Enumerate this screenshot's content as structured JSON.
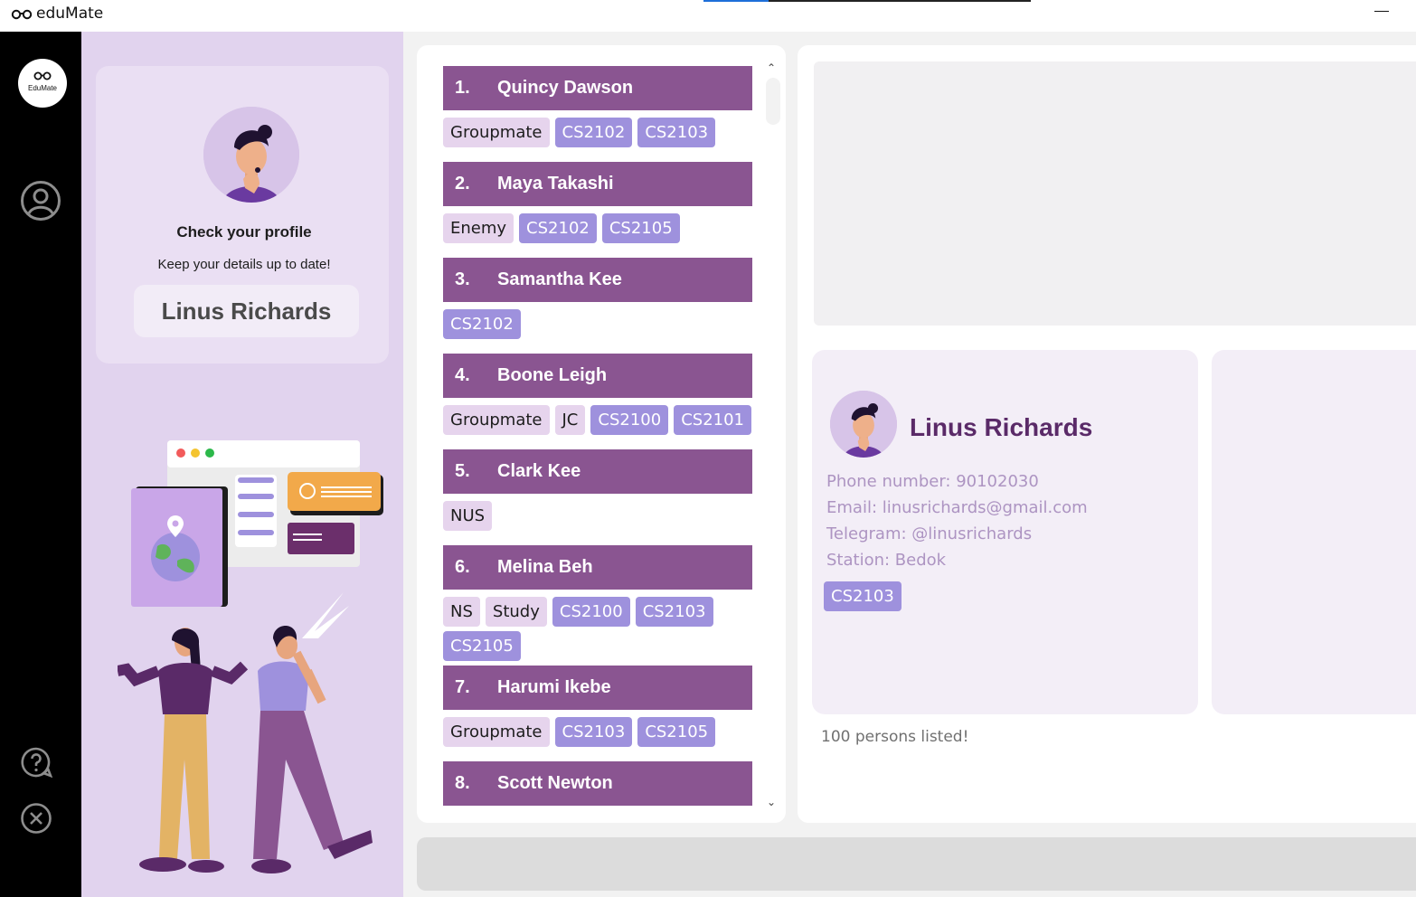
{
  "window": {
    "title": "eduMate"
  },
  "rail": {
    "logo_text": "EduMate"
  },
  "profile_card": {
    "heading": "Check your profile",
    "subheading": "Keep your details up to date!",
    "name": "Linus Richards"
  },
  "persons": [
    {
      "index": "1.",
      "name": "Quincy Dawson",
      "tags": [
        {
          "label": "Groupmate",
          "kind": "plain"
        },
        {
          "label": "CS2102",
          "kind": "mod"
        },
        {
          "label": "CS2103",
          "kind": "mod"
        }
      ]
    },
    {
      "index": "2.",
      "name": "Maya Takashi",
      "tags": [
        {
          "label": "Enemy",
          "kind": "plain"
        },
        {
          "label": "CS2102",
          "kind": "mod"
        },
        {
          "label": "CS2105",
          "kind": "mod"
        }
      ]
    },
    {
      "index": "3.",
      "name": "Samantha Kee",
      "tags": [
        {
          "label": "CS2102",
          "kind": "mod"
        }
      ]
    },
    {
      "index": "4.",
      "name": "Boone Leigh",
      "tags": [
        {
          "label": "Groupmate",
          "kind": "plain"
        },
        {
          "label": "JC",
          "kind": "plain"
        },
        {
          "label": "CS2100",
          "kind": "mod"
        },
        {
          "label": "CS2101",
          "kind": "mod"
        }
      ]
    },
    {
      "index": "5.",
      "name": "Clark Kee",
      "tags": [
        {
          "label": "NUS",
          "kind": "plain"
        }
      ]
    },
    {
      "index": "6.",
      "name": "Melina Beh",
      "tags": [
        {
          "label": "NS",
          "kind": "plain"
        },
        {
          "label": "Study",
          "kind": "plain"
        },
        {
          "label": "CS2100",
          "kind": "mod"
        },
        {
          "label": "CS2103",
          "kind": "mod"
        },
        {
          "label": "CS2105",
          "kind": "mod"
        }
      ]
    },
    {
      "index": "7.",
      "name": "Harumi Ikebe",
      "tags": [
        {
          "label": "Groupmate",
          "kind": "plain"
        },
        {
          "label": "CS2103",
          "kind": "mod"
        },
        {
          "label": "CS2105",
          "kind": "mod"
        }
      ]
    },
    {
      "index": "8.",
      "name": "Scott Newton",
      "tags": []
    }
  ],
  "detail": {
    "name": "Linus Richards",
    "phone": "Phone number: 90102030",
    "email": "Email: linusrichards@gmail.com",
    "telegram": "Telegram: @linusrichards",
    "station": "Station: Bedok",
    "tag": "CS2103"
  },
  "status": "100 persons listed!",
  "command": {
    "value": ""
  },
  "colors": {
    "header": "#8a5591",
    "plain_tag": "#e6d4ed",
    "module_tag": "#9e91dd",
    "left_panel": "#e1d3ee",
    "detail_name": "#5a2a68",
    "detail_text": "#ad94c2"
  }
}
